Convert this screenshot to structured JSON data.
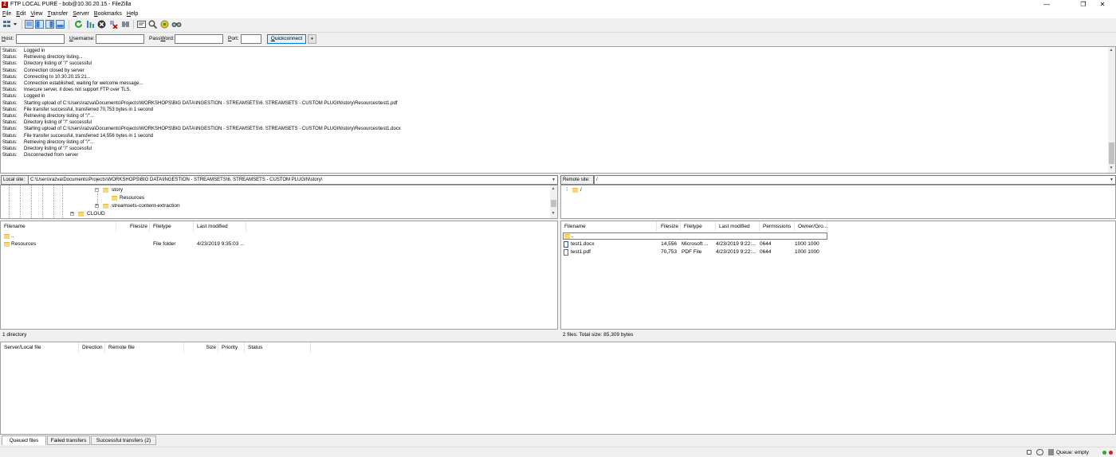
{
  "window": {
    "title": "FTP LOCAL PURE - bob@10.30.20.15 - FileZilla",
    "app_icon_glyph": "Z",
    "minimize_glyph": "—",
    "maximize_glyph": "❐",
    "close_glyph": "✕"
  },
  "menu": [
    {
      "key": "F",
      "rest": "ile"
    },
    {
      "key": "E",
      "rest": "dit"
    },
    {
      "key": "V",
      "rest": "iew"
    },
    {
      "key": "T",
      "rest": "ransfer"
    },
    {
      "key": "S",
      "rest": "erver"
    },
    {
      "key": "B",
      "rest": "ookmarks"
    },
    {
      "key": "H",
      "rest": "elp"
    }
  ],
  "toolbar": {
    "icons": [
      "site-manager-icon",
      "toggle-log-icon",
      "toggle-local-tree-icon",
      "toggle-remote-tree-icon",
      "toggle-queue-icon",
      "refresh-icon",
      "process-queue-icon",
      "cancel-icon",
      "disconnect-icon",
      "reconnect-icon",
      "filter-icon",
      "compare-icon",
      "sync-browse-icon",
      "search-icon"
    ],
    "colors": {
      "refresh": "#2e9c3a",
      "cancel": "#333333",
      "disconnect": "#c00000",
      "accent": "#1e6fc8"
    }
  },
  "quickconnect": {
    "host_key": "H",
    "host_rest": "ost:",
    "username_key": "U",
    "username_rest": "sername:",
    "password_key": "W",
    "password_pre": "Pass",
    "password_rest": "ord:",
    "port_key": "P",
    "port_rest": "ort:",
    "host_value": "",
    "username_value": "",
    "password_value": "",
    "port_value": "",
    "button_key": "Q",
    "button_rest": "uickconnect",
    "dropdown_glyph": "▾"
  },
  "log": [
    {
      "label": "Status:",
      "text": "Logged in"
    },
    {
      "label": "Status:",
      "text": "Retrieving directory listing..."
    },
    {
      "label": "Status:",
      "text": "Directory listing of \"/\" successful"
    },
    {
      "label": "Status:",
      "text": "Connection closed by server"
    },
    {
      "label": "Status:",
      "text": "Connecting to 10.30.20.15:21..."
    },
    {
      "label": "Status:",
      "text": "Connection established, waiting for welcome message..."
    },
    {
      "label": "Status:",
      "text": "Insecure server, it does not support FTP over TLS."
    },
    {
      "label": "Status:",
      "text": "Logged in"
    },
    {
      "label": "Status:",
      "text": "Starting upload of C:\\Users\\razva\\Documents\\Projects\\WORKSHOPS\\BIG DATA\\INGESTION - STREAMSETS\\6. STREAMSETS - CUSTOM PLUGIN\\story\\Resources\\test1.pdf"
    },
    {
      "label": "Status:",
      "text": "File transfer successful, transferred 70,753 bytes in 1 second"
    },
    {
      "label": "Status:",
      "text": "Retrieving directory listing of \"/\"..."
    },
    {
      "label": "Status:",
      "text": "Directory listing of \"/\" successful"
    },
    {
      "label": "Status:",
      "text": "Starting upload of C:\\Users\\razva\\Documents\\Projects\\WORKSHOPS\\BIG DATA\\INGESTION - STREAMSETS\\6. STREAMSETS - CUSTOM PLUGIN\\story\\Resources\\test1.docx"
    },
    {
      "label": "Status:",
      "text": "File transfer successful, transferred 14,556 bytes in 1 second"
    },
    {
      "label": "Status:",
      "text": "Retrieving directory listing of \"/\"..."
    },
    {
      "label": "Status:",
      "text": "Directory listing of \"/\" successful"
    },
    {
      "label": "Status:",
      "text": "Disconnected from server"
    }
  ],
  "local": {
    "site_label": "Local site:",
    "path": "C:\\Users\\razva\\Documents\\Projects\\WORKSHOPS\\BIG DATA\\INGESTION - STREAMSETS\\6. STREAMSETS - CUSTOM PLUGIN\\story\\",
    "tree": [
      {
        "label": "story",
        "expander": "−"
      },
      {
        "label": "Resources",
        "expander": ""
      },
      {
        "label": "streamsets-content-extraction",
        "expander": "+"
      },
      {
        "label": "CLOUD",
        "expander": "+"
      }
    ],
    "columns": [
      "Filename",
      "Filesize",
      "Filetype",
      "Last modified"
    ],
    "rows": [
      {
        "name": "..",
        "size": "",
        "type": "",
        "modified": ""
      },
      {
        "name": "Resources",
        "size": "",
        "type": "File folder",
        "modified": "4/23/2019 9:35:03 ..."
      }
    ],
    "status": "1 directory"
  },
  "remote": {
    "site_label": "Remote site:",
    "path": "/",
    "tree": [
      {
        "label": "/",
        "expander": ""
      }
    ],
    "columns": [
      "Filename",
      "Filesize",
      "Filetype",
      "Last modified",
      "Permissions",
      "Owner/Gro..."
    ],
    "sort_glyph": "^",
    "rows": [
      {
        "name": "..",
        "size": "",
        "type": "",
        "modified": "",
        "perms": "",
        "owner": ""
      },
      {
        "name": "test1.docx",
        "size": "14,556",
        "type": "Microsoft ...",
        "modified": "4/23/2019 9:22:...",
        "perms": "0644",
        "owner": "1000 1000"
      },
      {
        "name": "test1.pdf",
        "size": "70,753",
        "type": "PDF File",
        "modified": "4/23/2019 9:22:...",
        "perms": "0644",
        "owner": "1000 1000"
      }
    ],
    "status": "2 files. Total size: 85,309 bytes"
  },
  "queue": {
    "columns": [
      "Server/Local file",
      "Direction",
      "Remote file",
      "Size",
      "Priority",
      "Status"
    ],
    "tabs": [
      "Queued files",
      "Failed transfers",
      "Successful transfers (2)"
    ],
    "status": "Queue: empty"
  },
  "status_colors": {
    "green": "#2fa82f",
    "red": "#d21e1e"
  }
}
